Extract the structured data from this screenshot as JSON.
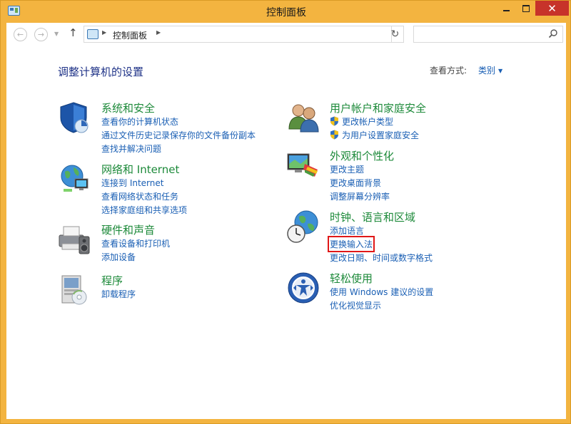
{
  "window": {
    "title": "控制面板",
    "close_glyph": "✕"
  },
  "nav": {
    "back_glyph": "←",
    "forward_glyph": "→",
    "dropdown_glyph": "▼",
    "up_glyph": "↑",
    "address_sep": "▶",
    "address_path": "控制面板",
    "refresh_glyph": "↻",
    "search_placeholder": ""
  },
  "content": {
    "heading": "调整计算机的设置",
    "viewby_label": "查看方式:",
    "viewby_value": "类别",
    "viewby_arrow": "▼"
  },
  "categories": [
    {
      "icon": "security-shield-icon",
      "title": "系统和安全",
      "links": [
        "查看你的计算机状态",
        "通过文件历史记录保存你的文件备份副本",
        "查找并解决问题"
      ]
    },
    {
      "icon": "network-globe-icon",
      "title": "网络和 Internet",
      "links": [
        "连接到 Internet",
        "查看网络状态和任务",
        "选择家庭组和共享选项"
      ]
    },
    {
      "icon": "printer-speaker-icon",
      "title": "硬件和声音",
      "links": [
        "查看设备和打印机",
        "添加设备"
      ]
    },
    {
      "icon": "programs-box-icon",
      "title": "程序",
      "links": [
        "卸载程序"
      ]
    },
    {
      "icon": "users-icon",
      "title": "用户帐户和家庭安全",
      "links": [
        "更改帐户类型",
        "为用户设置家庭安全"
      ]
    },
    {
      "icon": "appearance-monitor-icon",
      "title": "外观和个性化",
      "links": [
        "更改主题",
        "更改桌面背景",
        "调整屏幕分辨率"
      ]
    },
    {
      "icon": "clock-globe-icon",
      "title": "时钟、语言和区域",
      "links": [
        "添加语言",
        "更换输入法",
        "更改日期、时间或数字格式"
      ]
    },
    {
      "icon": "ease-of-access-icon",
      "title": "轻松使用",
      "links": [
        "使用 Windows 建议的设置",
        "优化视觉显示"
      ]
    }
  ],
  "colors": {
    "accent": "#f3b440",
    "heading": "#1e3287",
    "category_title": "#1d8a3a",
    "link": "#1a5fb4",
    "highlight": "#e01717"
  }
}
